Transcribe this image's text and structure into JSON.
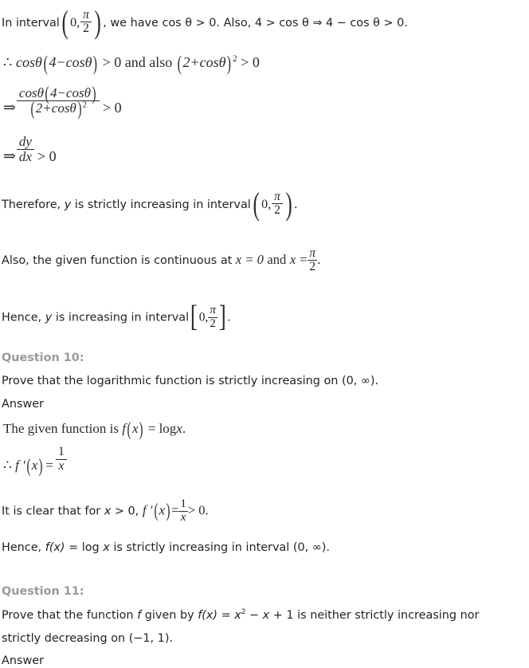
{
  "document": {
    "type": "math-solutions-page",
    "subject_topic": "Increasing and Decreasing Functions",
    "text_color": "#231f20",
    "heading_color": "#9a9a9a",
    "background_color": "#ffffff"
  },
  "lines": {
    "interval_statement": {
      "part1": "In interval",
      "interval_open": "(",
      "interval_zero": "0,",
      "pi": "π",
      "two": "2",
      "interval_close": ")",
      "part2": ", we have cos θ > 0. Also, 4 > cos θ ⇒ 4 − cos θ > 0."
    },
    "therefore_product": {
      "therefore": "∴",
      "expr": "cosθ(4−cosθ) > 0 and also (2+cosθ)² > 0",
      "lhs": "cosθ",
      "paren_open": "(",
      "four_minus": "4−cosθ",
      "paren_close": ")",
      "gt_zero": "> 0",
      "and_also": "and also",
      "sq_open": "(",
      "two_plus": "2+cosθ",
      "sq_close": ")",
      "power": "2",
      "gt_zero_2": "> 0"
    },
    "implies_fraction": {
      "implies": "⇒",
      "numerator_a": "cosθ",
      "numerator_open": "(",
      "numerator_b": "4−cosθ",
      "numerator_close": ")",
      "denominator_open": "(",
      "denominator_b": "2+cosθ",
      "denominator_close": ")",
      "denominator_power": "2",
      "gt_zero": "> 0"
    },
    "implies_derivative": {
      "implies": "⇒",
      "num": "dy",
      "den": "dx",
      "gt_zero": "> 0"
    },
    "therefore_increasing": {
      "part1": "Therefore, ",
      "y": "y",
      "part2": " is strictly increasing in interval",
      "open": "(",
      "zero": "0,",
      "pi": "π",
      "two": "2",
      "close": ")",
      "period": "."
    },
    "continuous_statement": {
      "part1": "Also, the given function is continuous at",
      "x_eq_0": "x = 0",
      "and": "and",
      "x_eq": "x =",
      "pi": "π",
      "two": "2",
      "period": "."
    },
    "hence_increasing": {
      "part1": "Hence, ",
      "y": "y",
      "part2": " is increasing in interval",
      "open": "[",
      "zero": "0,",
      "pi": "π",
      "two": "2",
      "close": "]",
      "period": "."
    }
  },
  "question10": {
    "heading": "Question 10:",
    "prompt": "Prove that the logarithmic function is strictly increasing on (0, ∞).",
    "answer_label": "Answer",
    "given_function": {
      "text": "The given function is ",
      "f": "f",
      "open": "(",
      "x": "x",
      "close": ")",
      "eq": "= log",
      "x2": "x",
      "period": "."
    },
    "derivative": {
      "therefore": "∴",
      "f_prime": "f ′",
      "open": "(",
      "x": "x",
      "close": ")",
      "eq": "=",
      "num": "1",
      "den": "x"
    },
    "clear_line": {
      "part1": "It is clear that for ",
      "x": "x",
      "part2": " > 0,",
      "f_prime": "f ′",
      "open": "(",
      "x_in": "x",
      "close": ")",
      "eq": "=",
      "num": "1",
      "den": "x",
      "gt_zero": "> 0."
    },
    "conclusion": {
      "part1": "Hence, ",
      "fx": "f(x)",
      "part2": " = log ",
      "x": "x",
      "part3": " is strictly increasing in interval (0, ∞)."
    }
  },
  "question11": {
    "heading": "Question 11:",
    "prompt_line1_a": "Prove that the function ",
    "prompt_line1_f": "f",
    "prompt_line1_b": " given by ",
    "prompt_line1_fx": "f(x)",
    "prompt_line1_c": " = ",
    "prompt_line1_x": "x",
    "prompt_line1_sup": "2",
    "prompt_line1_d": " − ",
    "prompt_line1_x2": "x",
    "prompt_line1_e": " + 1 is neither strictly increasing nor",
    "prompt_line2": "strictly decreasing on (−1, 1).",
    "answer_label": "Answer"
  }
}
